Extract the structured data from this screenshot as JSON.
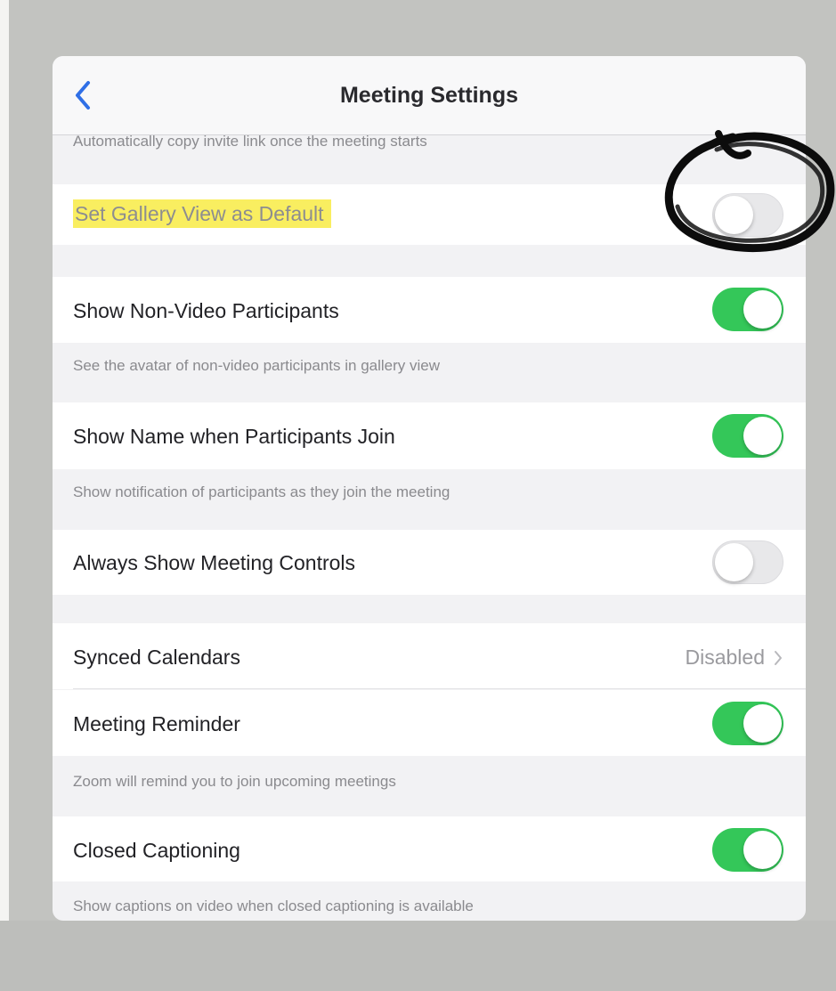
{
  "header": {
    "title": "Meeting Settings"
  },
  "settings": {
    "copy_invite_desc": "Automatically copy invite link once the meeting starts",
    "gallery_view": {
      "label": "Set Gallery View as Default",
      "enabled": false
    },
    "non_video": {
      "label": "Show Non-Video Participants",
      "desc": "See the avatar of non-video participants in gallery view",
      "enabled": true
    },
    "show_name": {
      "label": "Show Name when Participants Join",
      "desc": "Show notification of participants as they join the meeting",
      "enabled": true
    },
    "meeting_controls": {
      "label": "Always Show Meeting Controls",
      "enabled": false
    },
    "synced_calendars": {
      "label": "Synced Calendars",
      "value": "Disabled"
    },
    "reminder": {
      "label": "Meeting Reminder",
      "desc": "Zoom will remind you to join upcoming meetings",
      "enabled": true
    },
    "captioning": {
      "label": "Closed Captioning",
      "desc": "Show captions on video when closed captioning is available",
      "enabled": true
    }
  },
  "colors": {
    "accent_blue": "#2f6fe6",
    "toggle_on": "#34c759",
    "highlight": "#f9ee60"
  },
  "icons": {
    "back": "chevron-left-icon",
    "disclosure": "chevron-right-icon"
  }
}
